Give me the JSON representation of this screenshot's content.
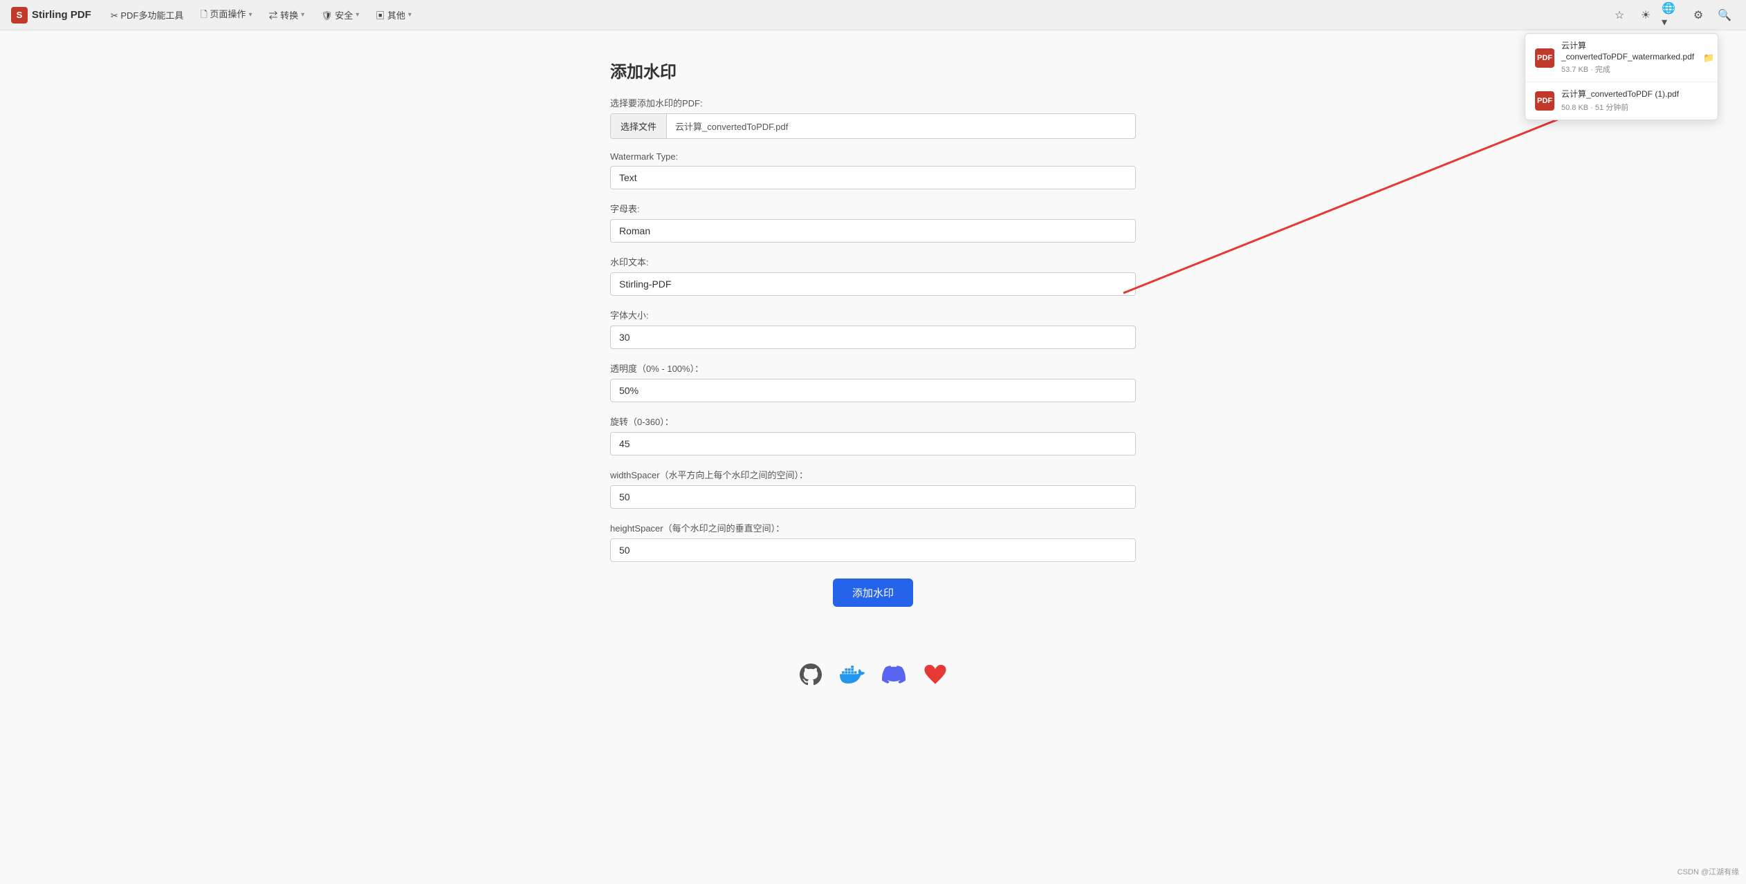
{
  "brand": {
    "logo_text": "S",
    "name": "Stirling PDF"
  },
  "navbar": {
    "items": [
      {
        "id": "pdf-tools",
        "label": "✂ PDF多功能工具",
        "has_dropdown": false
      },
      {
        "id": "page-ops",
        "label": "🗋 页面操作",
        "has_dropdown": true
      },
      {
        "id": "convert",
        "label": "⇄ 转换",
        "has_dropdown": true
      },
      {
        "id": "security",
        "label": "🛡 安全",
        "has_dropdown": true
      },
      {
        "id": "other",
        "label": "▣ 其他",
        "has_dropdown": true
      }
    ],
    "icons": [
      "star",
      "sun",
      "globe",
      "gear",
      "search"
    ]
  },
  "download_popup": {
    "items": [
      {
        "id": "file1",
        "filename": "云计算_convertedToPDF_watermarked.pdf",
        "size": "53.7 KB",
        "status": "完成",
        "meta": "53.7 KB · 完成"
      },
      {
        "id": "file2",
        "filename": "云计算_convertedToPDF (1).pdf",
        "size": "50.8 KB",
        "time": "51 分钟前",
        "meta": "50.8 KB · 51 分钟前"
      }
    ]
  },
  "page": {
    "title": "添加水印",
    "file_section": {
      "label": "选择要添加水印的PDF:",
      "button_label": "选择文件",
      "filename": "云计算_convertedToPDF.pdf"
    },
    "fields": [
      {
        "id": "watermark-type",
        "label": "Watermark Type:",
        "value": "Text"
      },
      {
        "id": "font",
        "label": "字母表:",
        "value": "Roman"
      },
      {
        "id": "watermark-text",
        "label": "水印文本:",
        "value": "Stirling-PDF"
      },
      {
        "id": "font-size",
        "label": "字体大小:",
        "value": "30"
      },
      {
        "id": "opacity",
        "label": "透明度（0% - 100%）：",
        "value": "50%"
      },
      {
        "id": "rotation",
        "label": "旋转（0-360）：",
        "value": "45"
      },
      {
        "id": "width-spacer",
        "label": "widthSpacer（水平方向上每个水印之间的空间）：",
        "value": "50"
      },
      {
        "id": "height-spacer",
        "label": "heightSpacer（每个水印之间的垂直空间）：",
        "value": "50"
      }
    ],
    "submit_label": "添加水印"
  },
  "footer": {
    "icons": [
      "github",
      "docker",
      "discord",
      "heart"
    ]
  },
  "csdn_watermark": "CSDN @江湖有缘"
}
